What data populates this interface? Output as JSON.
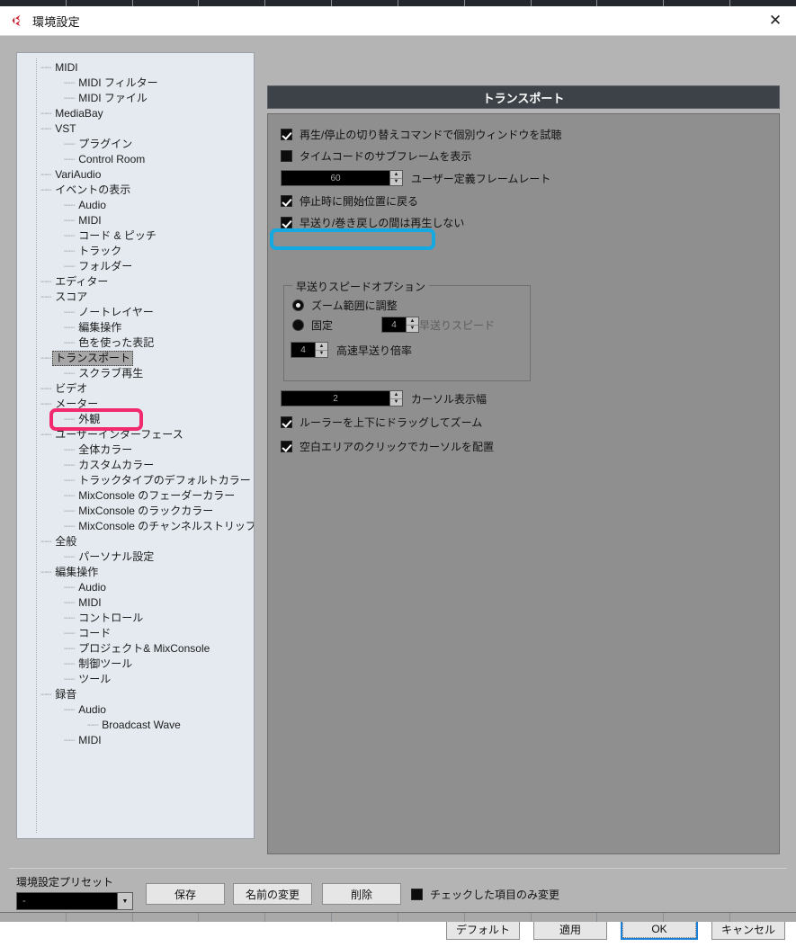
{
  "window": {
    "title": "環境設定",
    "icon": "cubase-logo-icon",
    "close_label": "✕"
  },
  "tree": {
    "items": [
      {
        "label": "MIDI",
        "level": 1,
        "selected": false
      },
      {
        "label": "MIDI フィルター",
        "level": 2,
        "selected": false
      },
      {
        "label": "MIDI ファイル",
        "level": 2,
        "selected": false
      },
      {
        "label": "MediaBay",
        "level": 1,
        "selected": false
      },
      {
        "label": "VST",
        "level": 1,
        "selected": false
      },
      {
        "label": "プラグイン",
        "level": 2,
        "selected": false
      },
      {
        "label": "Control Room",
        "level": 2,
        "selected": false
      },
      {
        "label": "VariAudio",
        "level": 1,
        "selected": false
      },
      {
        "label": "イベントの表示",
        "level": 1,
        "selected": false
      },
      {
        "label": "Audio",
        "level": 2,
        "selected": false
      },
      {
        "label": "MIDI",
        "level": 2,
        "selected": false
      },
      {
        "label": "コード & ピッチ",
        "level": 2,
        "selected": false
      },
      {
        "label": "トラック",
        "level": 2,
        "selected": false
      },
      {
        "label": "フォルダー",
        "level": 2,
        "selected": false
      },
      {
        "label": "エディター",
        "level": 1,
        "selected": false
      },
      {
        "label": "スコア",
        "level": 1,
        "selected": false
      },
      {
        "label": "ノートレイヤー",
        "level": 2,
        "selected": false
      },
      {
        "label": "編集操作",
        "level": 2,
        "selected": false
      },
      {
        "label": "色を使った表記",
        "level": 2,
        "selected": false
      },
      {
        "label": "トランスポート",
        "level": 1,
        "selected": true
      },
      {
        "label": "スクラブ再生",
        "level": 2,
        "selected": false
      },
      {
        "label": "ビデオ",
        "level": 1,
        "selected": false
      },
      {
        "label": "メーター",
        "level": 1,
        "selected": false
      },
      {
        "label": "外観",
        "level": 2,
        "selected": false
      },
      {
        "label": "ユーザーインターフェース",
        "level": 1,
        "selected": false
      },
      {
        "label": "全体カラー",
        "level": 2,
        "selected": false
      },
      {
        "label": "カスタムカラー",
        "level": 2,
        "selected": false
      },
      {
        "label": "トラックタイプのデフォルトカラー",
        "level": 2,
        "selected": false
      },
      {
        "label": "MixConsole のフェーダーカラー",
        "level": 2,
        "selected": false
      },
      {
        "label": "MixConsole のラックカラー",
        "level": 2,
        "selected": false
      },
      {
        "label": "MixConsole のチャンネルストリップカラー",
        "level": 2,
        "selected": false
      },
      {
        "label": "全般",
        "level": 1,
        "selected": false
      },
      {
        "label": "パーソナル設定",
        "level": 2,
        "selected": false
      },
      {
        "label": "編集操作",
        "level": 1,
        "selected": false
      },
      {
        "label": "Audio",
        "level": 2,
        "selected": false
      },
      {
        "label": "MIDI",
        "level": 2,
        "selected": false
      },
      {
        "label": "コントロール",
        "level": 2,
        "selected": false
      },
      {
        "label": "コード",
        "level": 2,
        "selected": false
      },
      {
        "label": "プロジェクト& MixConsole",
        "level": 2,
        "selected": false
      },
      {
        "label": "制御ツール",
        "level": 2,
        "selected": false
      },
      {
        "label": "ツール",
        "level": 2,
        "selected": false
      },
      {
        "label": "録音",
        "level": 1,
        "selected": false
      },
      {
        "label": "Audio",
        "level": 2,
        "selected": false
      },
      {
        "label": "Broadcast Wave",
        "level": 3,
        "selected": false
      },
      {
        "label": "MIDI",
        "level": 2,
        "selected": false
      }
    ]
  },
  "panel": {
    "header": "トランスポート",
    "options": {
      "audition_separate_window": {
        "label": "再生/停止の切り替えコマンドで個別ウィンドウを試聴",
        "checked": true
      },
      "show_subframes": {
        "label": "タイムコードのサブフレームを表示",
        "checked": false
      },
      "user_framerate": {
        "value": "60",
        "label": "ユーザー定義フレームレート"
      },
      "return_to_start": {
        "label": "停止時に開始位置に戻る",
        "checked": true
      },
      "no_playback_during_ff": {
        "label": "早送り/巻き戻しの間は再生しない",
        "checked": true
      }
    },
    "groupbox": {
      "title": "早送りスピードオプション",
      "radio_adjust_zoom": {
        "label": "ズーム範囲に調整",
        "selected": false
      },
      "radio_fixed": {
        "label": "固定",
        "selected": true
      },
      "ff_speed": {
        "value": "4",
        "label": "早送りスピード"
      },
      "fast_ff_factor": {
        "value": "4",
        "label": "高速早送り倍率"
      }
    },
    "cursor_width": {
      "value": "2",
      "label": "カーソル表示幅"
    },
    "ruler_drag_zoom": {
      "label": "ルーラーを上下にドラッグしてズーム",
      "checked": true
    },
    "blank_click_cursor": {
      "label": "空白エリアのクリックでカーソルを配置",
      "checked": true
    }
  },
  "preset_bar": {
    "label": "環境設定プリセット",
    "selected_value": "-",
    "save": "保存",
    "rename": "名前の変更",
    "delete": "削除",
    "only_checked": {
      "label": "チェックした項目のみ変更",
      "checked": false
    }
  },
  "actions": {
    "default": "デフォルト",
    "apply": "適用",
    "ok": "OK",
    "cancel": "キャンセル"
  },
  "annotations": {
    "pink_color": "#f2296d",
    "cyan_color": "#14a9e0"
  },
  "spinner": {
    "up": "▲",
    "down": "▼"
  },
  "dropdown": {
    "arrow": "▼"
  }
}
